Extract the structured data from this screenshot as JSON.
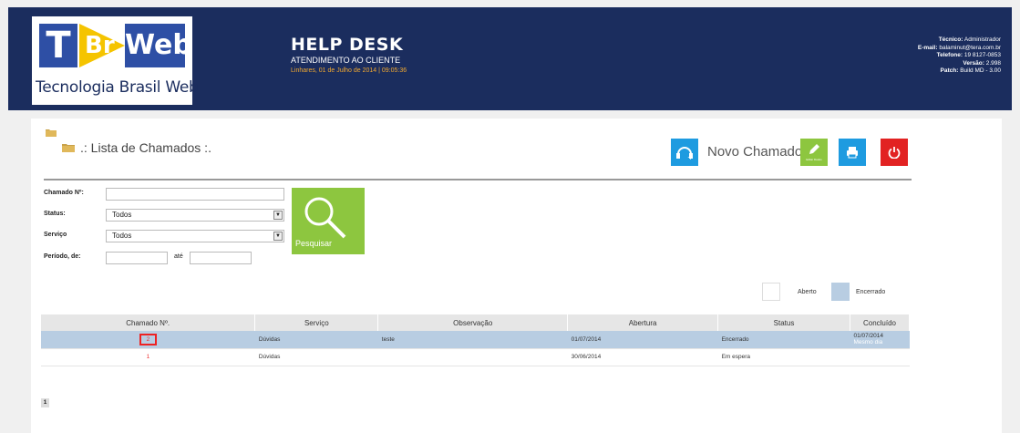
{
  "header": {
    "logo": {
      "letter": "T",
      "middle": "Br",
      "right": "Web",
      "caption": "Tecnologia Brasil Web"
    },
    "title": "HELP DESK",
    "subtitle": "ATENDIMENTO AO CLIENTE",
    "datetime": "Linhares, 01 de Julho de 2014  |  09:05:36",
    "info": {
      "tecnico_label": "Técnico:",
      "tecnico": "Administrador",
      "email_label": "E-mail:",
      "email": "balaminut@tera.com.br",
      "telefone_label": "Telefone:",
      "telefone": "19 8127-0853",
      "versao_label": "Versão:",
      "versao": "2.998",
      "patch_label": "Patch:",
      "patch": "Build MD - 3.00"
    }
  },
  "page": {
    "title": ".: Lista de Chamados :.",
    "novo_chamado": "Novo Chamado",
    "editar_label": "Editar Dados"
  },
  "form": {
    "chamado_label": "Chamado Nº:",
    "chamado_value": "",
    "status_label": "Status:",
    "status_value": "Todos",
    "servico_label": "Serviço",
    "servico_value": "Todos",
    "periodo_label": "Período, de:",
    "ate_label": "até",
    "periodo_de": "",
    "periodo_ate": "",
    "search_label": "Pesquisar"
  },
  "legend": {
    "aberto": "Aberto",
    "encerrado": "Encerrado"
  },
  "table": {
    "headers": [
      "Chamado Nº.",
      "Serviço",
      "Observação",
      "Abertura",
      "Status",
      "Concluído"
    ],
    "rows": [
      {
        "num": "2",
        "servico": "Dúvidas",
        "obs": "teste",
        "abertura": "01/07/2014",
        "status": "Encerrado",
        "concluido": "01/07/2014",
        "concluido_note": "Mesmo dia"
      },
      {
        "num": "1",
        "servico": "Dúvidas",
        "obs": "",
        "abertura": "30/06/2014",
        "status": "Em espera",
        "concluido": "",
        "concluido_note": ""
      }
    ]
  },
  "pager": {
    "current": "1"
  },
  "colors": {
    "header_bg": "#1b2d5e",
    "accent_green": "#8dc63f",
    "accent_blue": "#1e9be0",
    "accent_red": "#e22222",
    "closed_row": "#b8cde2",
    "date_orange": "#f0a830"
  },
  "icons": [
    "folder-icon",
    "headset-plus-icon",
    "pencil-icon",
    "printer-icon",
    "power-icon",
    "magnifier-icon"
  ]
}
